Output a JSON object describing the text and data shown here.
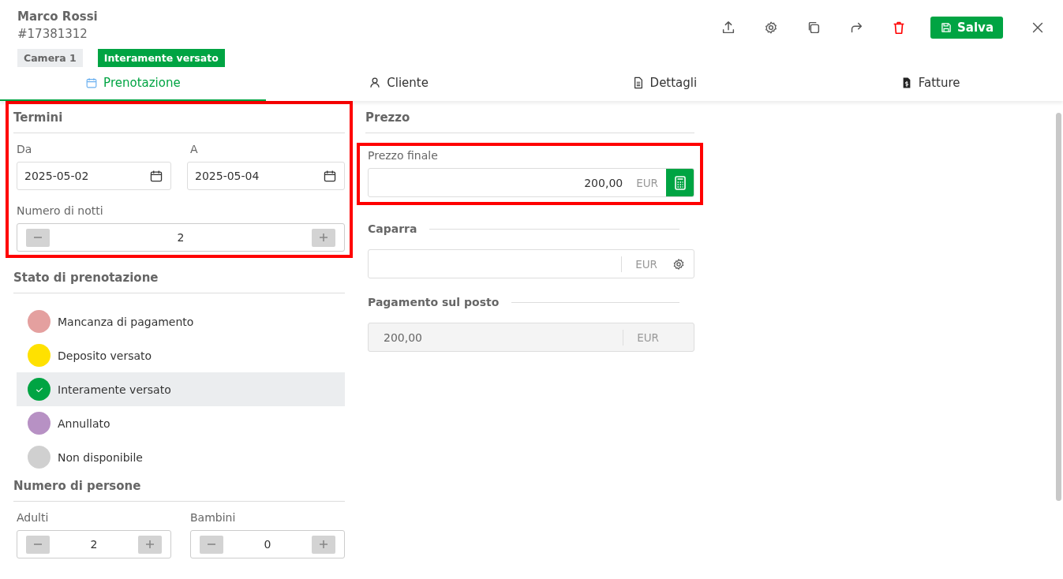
{
  "header": {
    "name": "Marco Rossi",
    "booking_id": "#17381312",
    "tags": [
      {
        "label": "Camera 1",
        "kind": "room"
      },
      {
        "label": "Interamente versato",
        "kind": "status",
        "color": "#00a443"
      }
    ],
    "save_button": "Salva"
  },
  "tabs": [
    {
      "label": "Prenotazione",
      "selected": true
    },
    {
      "label": "Cliente",
      "selected": false
    },
    {
      "label": "Dettagli",
      "selected": false
    },
    {
      "label": "Fatture",
      "selected": false
    }
  ],
  "termini": {
    "title": "Termini",
    "highlighted": true,
    "from": {
      "label": "Da",
      "value": "2025-05-02"
    },
    "to": {
      "label": "A",
      "value": "2025-05-04"
    },
    "nights": {
      "label": "Numero di notti",
      "value": "2"
    }
  },
  "stato": {
    "title": "Stato di prenotazione",
    "options": [
      {
        "label": "Mancanza di pagamento",
        "color": "#e4a09f",
        "selected": false
      },
      {
        "label": "Deposito versato",
        "color": "#ffe100",
        "selected": false
      },
      {
        "label": "Interamente versato",
        "color": "#00a443",
        "selected": true
      },
      {
        "label": "Annullato",
        "color": "#b791c4",
        "selected": false
      },
      {
        "label": "Non disponibile",
        "color": "#d0d0d0",
        "selected": false
      }
    ]
  },
  "persone": {
    "title": "Numero di persone",
    "adults": {
      "label": "Adulti",
      "value": "2"
    },
    "children": {
      "label": "Bambini",
      "value": "0"
    }
  },
  "prezzo": {
    "title": "Prezzo",
    "final": {
      "label": "Prezzo finale",
      "value": "200,00",
      "currency": "EUR",
      "highlighted": true
    },
    "deposit": {
      "label": "Caparra",
      "currency": "EUR"
    },
    "onsite": {
      "label": "Pagamento sul posto",
      "value": "200,00",
      "currency": "EUR",
      "disabled": true
    }
  }
}
